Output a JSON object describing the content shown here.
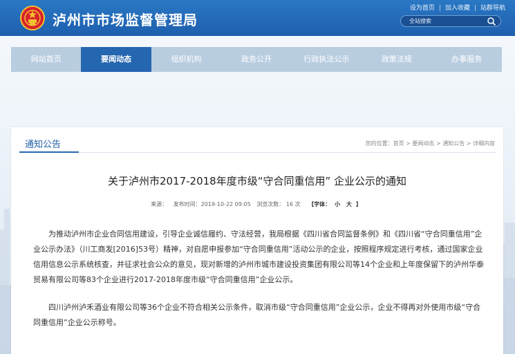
{
  "header": {
    "site_title": "泸州市市场监督管理局",
    "toplinks": [
      "设为首页",
      "加入收藏",
      "站群导航"
    ],
    "search_label": "全站搜索",
    "emblem_icon": "national-emblem-icon",
    "search_icon": "search-icon",
    "color": "#2266b0"
  },
  "nav": {
    "items": [
      "网站首页",
      "要闻动态",
      "组织机构",
      "政务公开",
      "行政执法公示",
      "政策法规",
      "办事服务"
    ],
    "active": "要闻动态",
    "active_color": "#2566b0",
    "bar_color": "#b9cde0"
  },
  "article": {
    "section_title": "通知公告",
    "breadcrumb": "您的位置：首页 > 要闻动态 > 通知公告 > 详细内容",
    "title": "关于泸州市2017-2018年度市级“守合同重信用” 企业公示的通知",
    "meta": {
      "source": "来源：",
      "publish_time": "发布时间：2019-10-22 09:05",
      "views": "浏览次数： 16  次",
      "font_label": "【字体：",
      "font_small": "小",
      "font_large": "大",
      "font_end": "】"
    },
    "paragraph1": "为推动泸州市企业合同信用建设，引导企业诚信履约、守法经营，我局根据《四川省合同监督条例》和《四川省“守合同重信用”企业公示办法》（川工商发[2016]53号）精神，对自愿申报参加“守合同重信用”活动公示的企业，按照程序规定进行考核，通过国家企业信用信息公示系统核查，并征求社会公众的意见，现对新增的泸州市城市建设投资集团有限公司等14个企业和上年度保留下的泸州华泰贸易有限公司等83个企业进行2017-2018年度市级“守合同重信用”企业公示。",
    "paragraph2": "四川泸州泸禾酒业有限公司等36个企业不符合相关公示条件，取消市级“守合同重信用”企业公示，企业不得再对外使用市级“守合同重信用”企业公示称号。"
  }
}
